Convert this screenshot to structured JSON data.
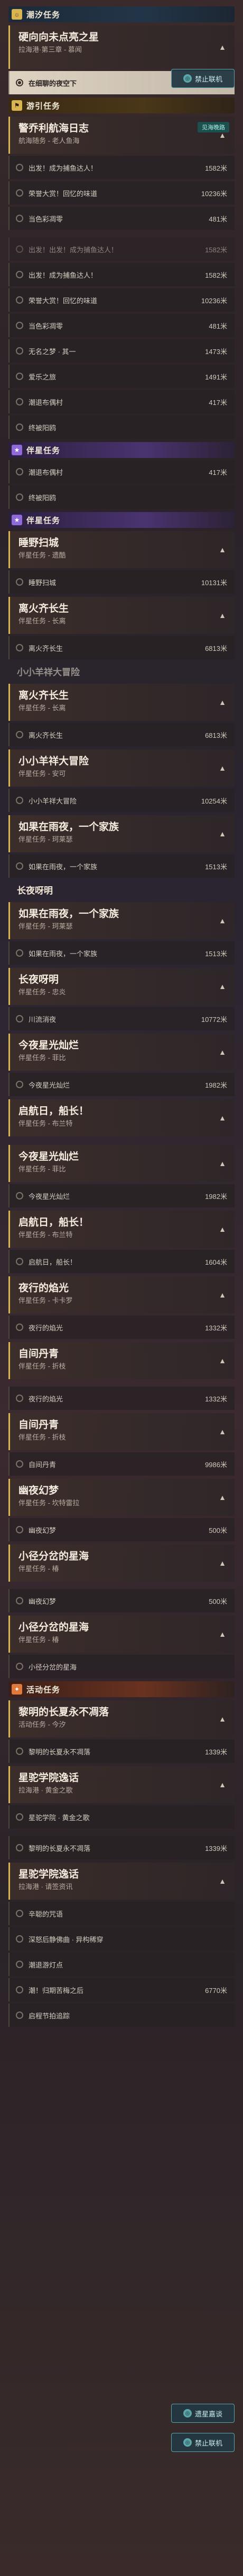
{
  "badges": {
    "forbid_link": "禁止联机",
    "lingqu": "遗星嘉谈",
    "yucheng": "见海晚路"
  },
  "sections": {
    "daily": "潮汐任务",
    "trail": "游引任务",
    "partner": "伴星任务",
    "event": "活动任务"
  },
  "blocks": [
    {
      "kind": "section",
      "style": "cyan",
      "icon": "sun-icon",
      "key": "daily"
    },
    {
      "kind": "quest",
      "title": "硬向向未点亮之星",
      "sub": "拉海港·第三章 - 慕闻",
      "tall": true
    },
    {
      "kind": "step",
      "text": "在细聊的夜空下",
      "dist": "",
      "active": true
    },
    {
      "kind": "section",
      "style": "gold",
      "icon": "flag-icon",
      "key": "trail"
    },
    {
      "kind": "quest",
      "title": "警乔利航海日志",
      "sub": "航海随务 - 老人鱼海",
      "tag": "见海晚路"
    },
    {
      "kind": "step",
      "text": "出发！成为捕鱼达人！",
      "dist": "1582米"
    },
    {
      "kind": "step",
      "text": "荣誉大赏！回忆的味道",
      "dist": "10236米"
    },
    {
      "kind": "step",
      "text": "当色彩凋零",
      "dist": "481米"
    },
    {
      "kind": "spacer"
    },
    {
      "kind": "step",
      "text": "出发！出发！成为捕鱼达人！",
      "dist": "1582米",
      "faded": true
    },
    {
      "kind": "step",
      "text": "出发！成为捕鱼达人！",
      "dist": "1582米"
    },
    {
      "kind": "step",
      "text": "荣誉大赏！回忆的味道",
      "dist": "10236米"
    },
    {
      "kind": "step",
      "text": "当色彩凋零",
      "dist": "481米"
    },
    {
      "kind": "step",
      "text": "无名之梦 · 其一",
      "dist": "1473米"
    },
    {
      "kind": "step",
      "text": "爱乐之旅",
      "dist": "1491米"
    },
    {
      "kind": "step",
      "text": "潮退布偶村",
      "dist": "417米"
    },
    {
      "kind": "step",
      "text": "终被阳鸥",
      "dist": ""
    },
    {
      "kind": "section",
      "style": "purple",
      "icon": "star-icon",
      "key": "partner"
    },
    {
      "kind": "step",
      "text": "潮退布偶村",
      "dist": "417米"
    },
    {
      "kind": "step",
      "text": "终被阳鸥",
      "dist": ""
    },
    {
      "kind": "section",
      "style": "purple",
      "icon": "star-icon",
      "key": "partner"
    },
    {
      "kind": "quest",
      "title": "睡野扫城",
      "sub": "伴星任务 - 遗酷"
    },
    {
      "kind": "step",
      "text": "睡野扫城",
      "dist": "10131米"
    },
    {
      "kind": "quest",
      "title": "离火齐长生",
      "sub": "伴星任务 - 长离"
    },
    {
      "kind": "step",
      "text": "离火齐长生",
      "dist": "6813米"
    },
    {
      "kind": "heading",
      "text": "小小羊祥大冒险",
      "faded": true
    },
    {
      "kind": "quest",
      "title": "离火齐长生",
      "sub": "伴星任务 - 长离"
    },
    {
      "kind": "step",
      "text": "离火齐长生",
      "dist": "6813米"
    },
    {
      "kind": "quest",
      "title": "小小羊祥大冒险",
      "sub": "伴星任务 - 安可"
    },
    {
      "kind": "step",
      "text": "小小羊祥大冒险",
      "dist": "10254米"
    },
    {
      "kind": "quest",
      "title": "如果在雨夜，一个家族",
      "sub": "伴星任务 - 珂莱瑟"
    },
    {
      "kind": "step",
      "text": "如果在雨夜，一个家族",
      "dist": "1513米"
    },
    {
      "kind": "heading",
      "text": "长夜呀明",
      "faded": false
    },
    {
      "kind": "quest",
      "title": "如果在雨夜，一个家族",
      "sub": "伴星任务 - 珂莱瑟"
    },
    {
      "kind": "step",
      "text": "如果在雨夜，一个家族",
      "dist": "1513米"
    },
    {
      "kind": "quest",
      "title": "长夜呀明",
      "sub": "伴星任务 - 忠炎"
    },
    {
      "kind": "step",
      "text": "川流消夜",
      "dist": "10772米"
    },
    {
      "kind": "quest",
      "title": "今夜星光灿烂",
      "sub": "伴星任务 - 菲比"
    },
    {
      "kind": "step",
      "text": "今夜星光灿烂",
      "dist": "1982米"
    },
    {
      "kind": "quest",
      "title": "启航日，船长！",
      "sub": "伴星任务 - 布兰特"
    },
    {
      "kind": "spacer"
    },
    {
      "kind": "quest",
      "title": "今夜星光灿烂",
      "sub": "伴星任务 - 菲比"
    },
    {
      "kind": "step",
      "text": "今夜星光灿烂",
      "dist": "1982米"
    },
    {
      "kind": "quest",
      "title": "启航日，船长！",
      "sub": "伴星任务 - 布兰特"
    },
    {
      "kind": "step",
      "text": "启航日，船长！",
      "dist": "1604米"
    },
    {
      "kind": "quest",
      "title": "夜行的焰光",
      "sub": "伴星任务 - 卡卡罗"
    },
    {
      "kind": "step",
      "text": "夜行的焰光",
      "dist": "1332米"
    },
    {
      "kind": "quest",
      "title": "自间丹青",
      "sub": "伴星任务 - 折枝"
    },
    {
      "kind": "spacer"
    },
    {
      "kind": "step",
      "text": "夜行的焰光",
      "dist": "1332米"
    },
    {
      "kind": "quest",
      "title": "自间丹青",
      "sub": "伴星任务 - 折枝"
    },
    {
      "kind": "step",
      "text": "自间丹青",
      "dist": "9986米"
    },
    {
      "kind": "quest",
      "title": "幽夜幻梦",
      "sub": "伴星任务 - 坎特雷拉"
    },
    {
      "kind": "step",
      "text": "幽夜幻梦",
      "dist": "500米"
    },
    {
      "kind": "quest",
      "title": "小径分岔的星海",
      "sub": "伴星任务 - 椿"
    },
    {
      "kind": "spacer"
    },
    {
      "kind": "step",
      "text": "幽夜幻梦",
      "dist": "500米"
    },
    {
      "kind": "quest",
      "title": "小径分岔的星海",
      "sub": "伴星任务 - 椿"
    },
    {
      "kind": "step",
      "text": "小径分岔的星海",
      "dist": ""
    },
    {
      "kind": "section",
      "style": "orange",
      "icon": "fire-icon",
      "key": "event"
    },
    {
      "kind": "quest",
      "title": "黎明的长夏永不凋落",
      "sub": "活动任务 - 今汐"
    },
    {
      "kind": "step",
      "text": "黎明的长夏永不凋落",
      "dist": "1339米"
    },
    {
      "kind": "quest",
      "title": "星驼学院逸话",
      "sub": "拉海港 · 黄金之歌"
    },
    {
      "kind": "step",
      "text": "星驼学院 · 黄金之歌",
      "dist": ""
    },
    {
      "kind": "spacer"
    },
    {
      "kind": "step",
      "text": "黎明的长夏永不凋落",
      "dist": "1339米"
    },
    {
      "kind": "quest",
      "title": "星驼学院逸话",
      "sub": "拉海港 · 请签资讯"
    },
    {
      "kind": "step",
      "text": "辛聪的咒语",
      "dist": ""
    },
    {
      "kind": "step",
      "text": "深怒后静佛曲 · 异构稀穿",
      "dist": ""
    },
    {
      "kind": "step",
      "text": "潮退游灯点",
      "dist": ""
    },
    {
      "kind": "step",
      "text": "潮！归期苦梅之后",
      "dist": "6770米"
    },
    {
      "kind": "step",
      "text": "启程节拍追踪",
      "dist": ""
    }
  ]
}
